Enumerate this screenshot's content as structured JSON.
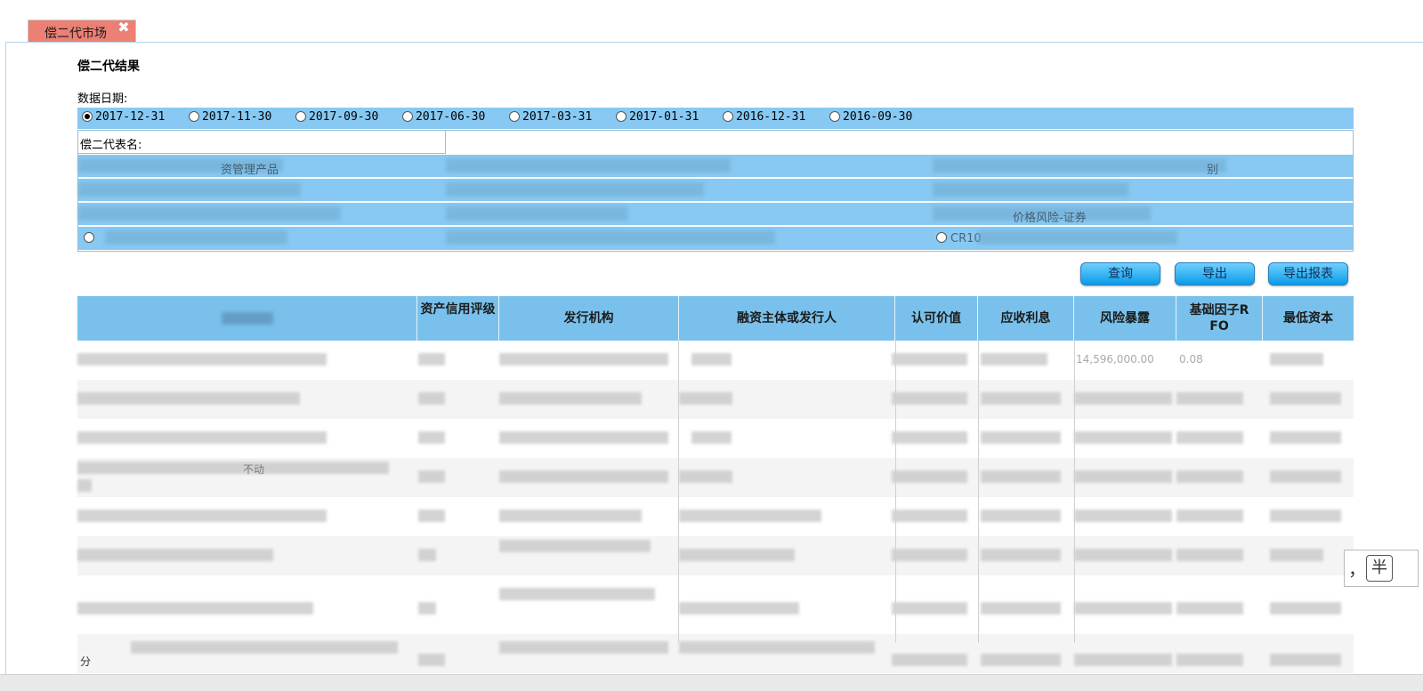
{
  "tab": {
    "label": "偿二代市场",
    "close_icon": "close-icon"
  },
  "section_title": "偿二代结果",
  "date_label": "数据日期:",
  "dates": [
    {
      "label": "2017-12-31",
      "selected": true
    },
    {
      "label": "2017-11-30",
      "selected": false
    },
    {
      "label": "2017-09-30",
      "selected": false
    },
    {
      "label": "2017-06-30",
      "selected": false
    },
    {
      "label": "2017-03-31",
      "selected": false
    },
    {
      "label": "2017-01-31",
      "selected": false
    },
    {
      "label": "2016-12-31",
      "selected": false
    },
    {
      "label": "2016-09-30",
      "selected": false
    }
  ],
  "table_names": {
    "label": "偿二代表名:",
    "visible_fragments": [
      "资管理产品",
      "别",
      "价格风险-证券",
      "CR10"
    ]
  },
  "buttons": {
    "query": "查询",
    "export": "导出",
    "export_report": "导出报表"
  },
  "columns": [
    "",
    "资产信用评级",
    "发行机构",
    "融资主体或发行人",
    "认可价值",
    "应收利息",
    "风险暴露",
    "基础因子RFO",
    "最低资本"
  ],
  "column_display": {
    "c1": "资产信用评\n级",
    "c7": "基础因子\nRFO"
  },
  "visible_cell_fragments": {
    "row1_exposure": "14,596,000.00",
    "row1_rfo": "0.08",
    "row4_text": "不动",
    "last_row_text": "分"
  },
  "ime": {
    "comma": "，",
    "half": "半"
  },
  "colors": {
    "tab": "#ec8075",
    "header_blue": "#79c1ec",
    "strip_blue": "#87c9f3",
    "button_blue": "#0a9be8"
  }
}
